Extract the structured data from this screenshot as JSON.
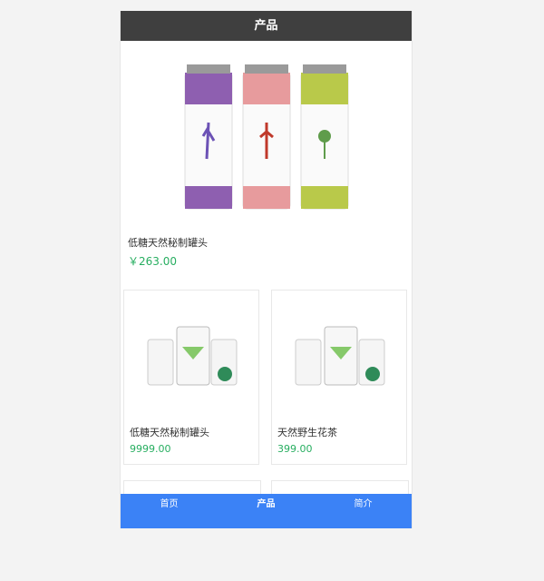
{
  "header": {
    "title": "产品"
  },
  "featured": {
    "name": "低糖天然秘制罐头",
    "price": "￥263.00"
  },
  "products": [
    {
      "name": "低糖天然秘制罐头",
      "price": "9999.00"
    },
    {
      "name": "天然野生花茶",
      "price": "399.00"
    }
  ],
  "tabbar": {
    "items": [
      {
        "label": "首页"
      },
      {
        "label": "产品"
      },
      {
        "label": "简介"
      }
    ],
    "active_index": 1
  },
  "colors": {
    "header_bg": "#3f3f3f",
    "tabbar_bg": "#3b82f6",
    "price": "#27ae60"
  }
}
